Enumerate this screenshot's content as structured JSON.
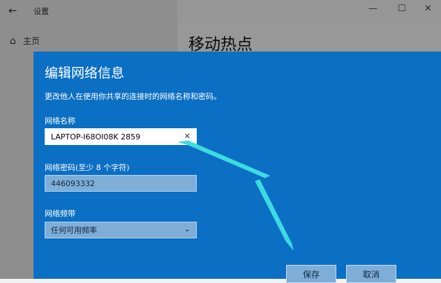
{
  "window": {
    "title": "设置",
    "back_icon": "back-arrow-icon",
    "controls": {
      "minimize": "—",
      "maximize": "☐",
      "close": "✕"
    }
  },
  "sidebar": {
    "home_label": "主页",
    "home_icon": "home-icon"
  },
  "page": {
    "title": "移动热点"
  },
  "dialog": {
    "title": "编辑网络信息",
    "description": "更改他人在使用你共享的连接时的网络名称和密码。",
    "network_name_label": "网络名称",
    "network_name_value": "LAPTOP-I68OI08K 2859",
    "password_label": "网络密码(至少 8 个字符)",
    "password_value": "446093332",
    "band_label": "网络频带",
    "band_value": "任何可用频率",
    "save_label": "保存",
    "cancel_label": "取消"
  },
  "colors": {
    "dialog_bg": "#0b6fc4",
    "arrow": "#3ddbe0",
    "field_dim": "#7eaed8"
  }
}
